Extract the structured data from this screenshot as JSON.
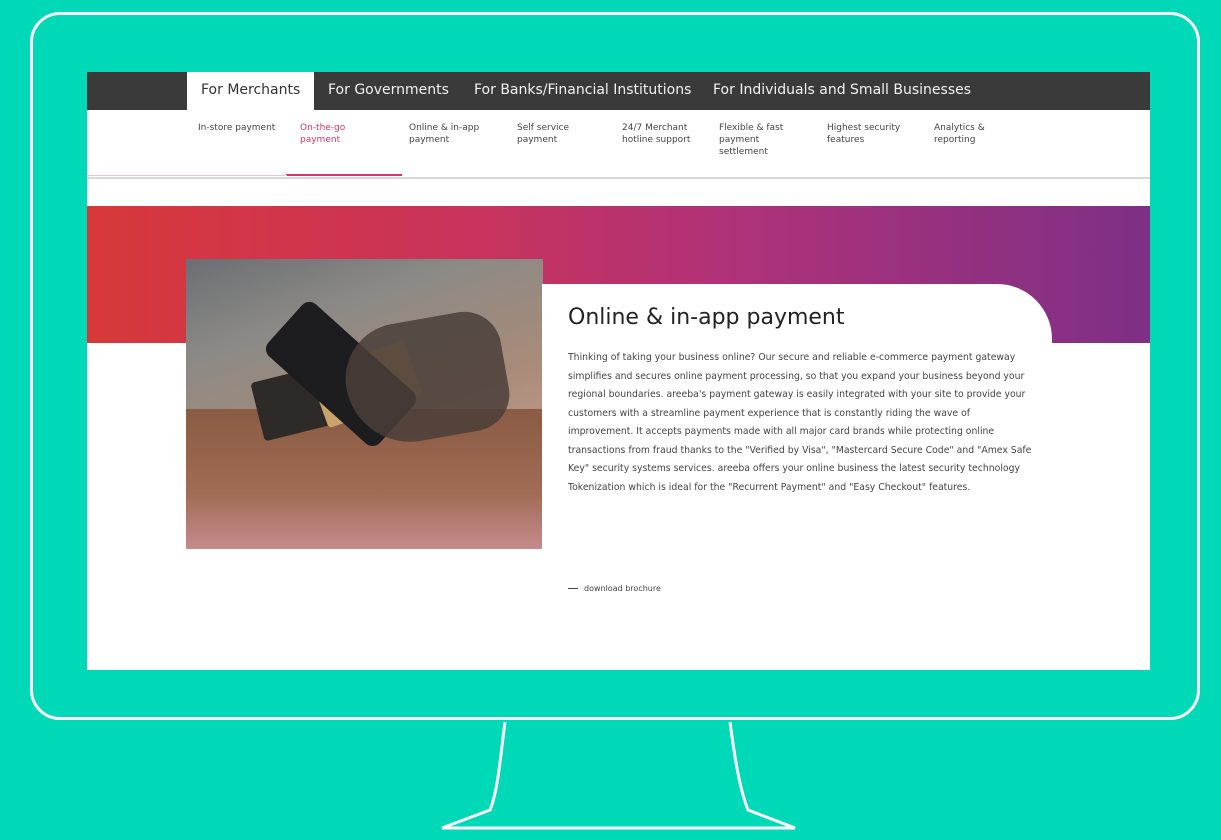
{
  "top_tabs": [
    {
      "label": "For Merchants",
      "active": true
    },
    {
      "label": "For Governments",
      "active": false
    },
    {
      "label": "For Banks/Financial Institutions",
      "active": false
    },
    {
      "label": "For Individuals and Small Businesses",
      "active": false
    }
  ],
  "sub_nav": [
    {
      "label": "In-store payment",
      "active": false
    },
    {
      "label": "On-the-go payment",
      "active": true
    },
    {
      "label": "Online & in-app payment",
      "active": false
    },
    {
      "label": "Self service payment",
      "active": false
    },
    {
      "label": "24/7 Merchant hotline support",
      "active": false
    },
    {
      "label": "Flexible & fast payment settlement",
      "active": false
    },
    {
      "label": "Highest security features",
      "active": false
    },
    {
      "label": "Analytics & reporting",
      "active": false
    }
  ],
  "hero": {
    "title": "Online & in-app payment",
    "body": "Thinking of taking your business online? Our secure and reliable e-commerce payment gateway simplifies and secures online payment processing, so that you expand your business beyond your regional boundaries. areeba's payment gateway is easily integrated with your site to provide your customers with a streamline payment experience that is constantly riding the wave of improvement. It accepts payments made with all major card brands while protecting online transactions from fraud thanks to the \"Verified by Visa\", \"Mastercard Secure Code\" and \"Amex Safe Key\" security systems services. areeba offers your online business the latest security technology Tokenization which is ideal for the \"Recurrent Payment\" and \"Easy Checkout\" features.",
    "download_label": "download brochure"
  },
  "colors": {
    "background": "#00d9b8",
    "accent": "#d6336c",
    "nav_bg": "#3a3a3a"
  }
}
